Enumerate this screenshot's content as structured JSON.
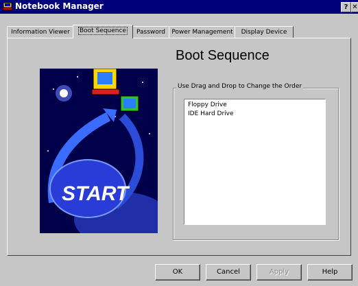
{
  "window": {
    "title": "Notebook Manager",
    "help_glyph": "?",
    "close_glyph": "✕"
  },
  "tabs": [
    {
      "label": "Information Viewer",
      "active": false
    },
    {
      "label": "Boot Sequence",
      "active": true
    },
    {
      "label": "Password",
      "active": false
    },
    {
      "label": "Power Management",
      "active": false
    },
    {
      "label": "Display Device",
      "active": false
    }
  ],
  "content": {
    "heading": "Boot Sequence",
    "group_label": "Use Drag and Drop to Change the Order",
    "boot_list": [
      "Floppy Drive",
      "IDE Hard Drive"
    ],
    "art_text": "START"
  },
  "buttons": {
    "ok": "OK",
    "cancel": "Cancel",
    "apply": "Apply",
    "help": "Help"
  },
  "colors": {
    "titlebar": "#00007b",
    "face": "#c6c6c6",
    "art_sky": "#00004a"
  },
  "icons": {
    "app": "notebook-icon",
    "help": "help-icon",
    "close": "close-icon"
  }
}
